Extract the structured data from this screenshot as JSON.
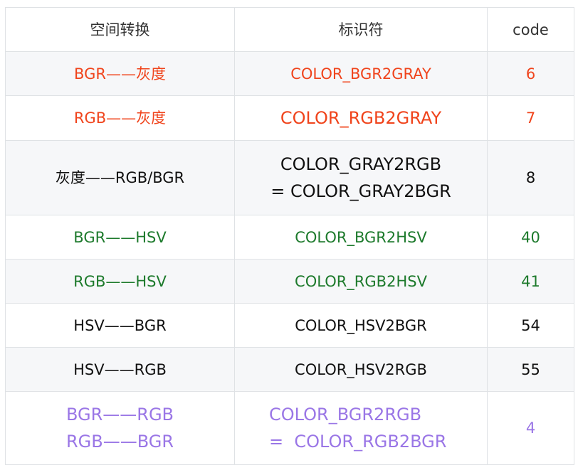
{
  "headers": [
    "空间转换",
    "标识符",
    "code"
  ],
  "colors": {
    "red": "#f0441c",
    "black": "#111111",
    "green": "#1d7a2c",
    "purple": "#9a76e6"
  },
  "rows": [
    {
      "space": [
        "BGR——灰度"
      ],
      "identifier": [
        "COLOR_BGR2GRAY"
      ],
      "code": "6",
      "color": "red"
    },
    {
      "space": [
        "RGB——灰度"
      ],
      "identifier": [
        "COLOR_RGB2GRAY"
      ],
      "code": "7",
      "color": "red"
    },
    {
      "space": [
        "灰度——RGB/BGR"
      ],
      "identifier": [
        "COLOR_GRAY2RGB",
        "= COLOR_GRAY2BGR"
      ],
      "code": "8",
      "color": "black"
    },
    {
      "space": [
        "BGR——HSV"
      ],
      "identifier": [
        "COLOR_BGR2HSV"
      ],
      "code": "40",
      "color": "green"
    },
    {
      "space": [
        "RGB——HSV"
      ],
      "identifier": [
        "COLOR_RGB2HSV"
      ],
      "code": "41",
      "color": "green"
    },
    {
      "space": [
        "HSV——BGR"
      ],
      "identifier": [
        "COLOR_HSV2BGR"
      ],
      "code": "54",
      "color": "black"
    },
    {
      "space": [
        "HSV——RGB"
      ],
      "identifier": [
        "COLOR_HSV2RGB"
      ],
      "code": "55",
      "color": "black"
    },
    {
      "space": [
        "BGR——RGB",
        "RGB——BGR"
      ],
      "identifier": [
        "COLOR_BGR2RGB",
        "=  COLOR_RGB2BGR"
      ],
      "code": "4",
      "color": "purple"
    }
  ]
}
